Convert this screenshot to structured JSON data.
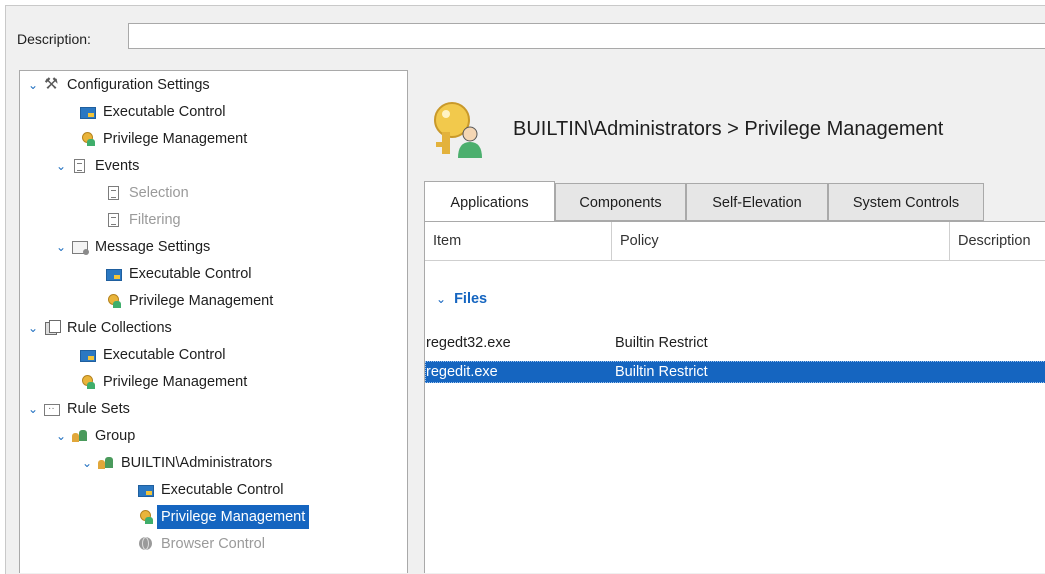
{
  "description": {
    "label": "Description:",
    "value": ""
  },
  "tree": {
    "items": [
      {
        "label": "Configuration Settings",
        "icon": "tools-icon",
        "expanded": true
      },
      {
        "label": "Executable Control",
        "icon": "executable-control-icon"
      },
      {
        "label": "Privilege Management",
        "icon": "privilege-management-icon"
      },
      {
        "label": "Events",
        "icon": "events-icon",
        "expanded": true
      },
      {
        "label": "Selection",
        "icon": "document-icon",
        "disabled": true
      },
      {
        "label": "Filtering",
        "icon": "document-icon",
        "disabled": true
      },
      {
        "label": "Message Settings",
        "icon": "message-settings-icon",
        "expanded": true
      },
      {
        "label": "Executable Control",
        "icon": "executable-control-icon"
      },
      {
        "label": "Privilege Management",
        "icon": "privilege-management-icon"
      },
      {
        "label": "Rule Collections",
        "icon": "rule-collections-icon",
        "expanded": true
      },
      {
        "label": "Executable Control",
        "icon": "executable-control-icon"
      },
      {
        "label": "Privilege Management",
        "icon": "privilege-management-icon"
      },
      {
        "label": "Rule Sets",
        "icon": "rule-sets-icon",
        "expanded": true
      },
      {
        "label": "Group",
        "icon": "group-icon",
        "expanded": true
      },
      {
        "label": "BUILTIN\\Administrators",
        "icon": "group-icon",
        "expanded": true
      },
      {
        "label": "Executable Control",
        "icon": "executable-control-icon"
      },
      {
        "label": "Privilege Management",
        "icon": "privilege-management-icon",
        "selected": true
      },
      {
        "label": "Browser Control",
        "icon": "browser-control-icon",
        "disabled": true
      }
    ]
  },
  "header": {
    "title": "BUILTIN\\Administrators > Privilege Management",
    "icon": "privilege-management-large-icon"
  },
  "tabs": [
    {
      "label": "Applications",
      "active": true
    },
    {
      "label": "Components"
    },
    {
      "label": "Self-Elevation"
    },
    {
      "label": "System Controls"
    }
  ],
  "grid": {
    "columns": [
      "Item",
      "Policy",
      "Description"
    ],
    "group": {
      "label": "Files",
      "expanded": true
    },
    "rows": [
      {
        "item": "regedt32.exe",
        "policy": "Builtin Restrict",
        "selected": false
      },
      {
        "item": "regedit.exe",
        "policy": "Builtin Restrict",
        "selected": true
      }
    ]
  },
  "colors": {
    "selection": "#1565c0",
    "accent_text": "#1565c0",
    "panel_bg": "#f0f0f0"
  }
}
